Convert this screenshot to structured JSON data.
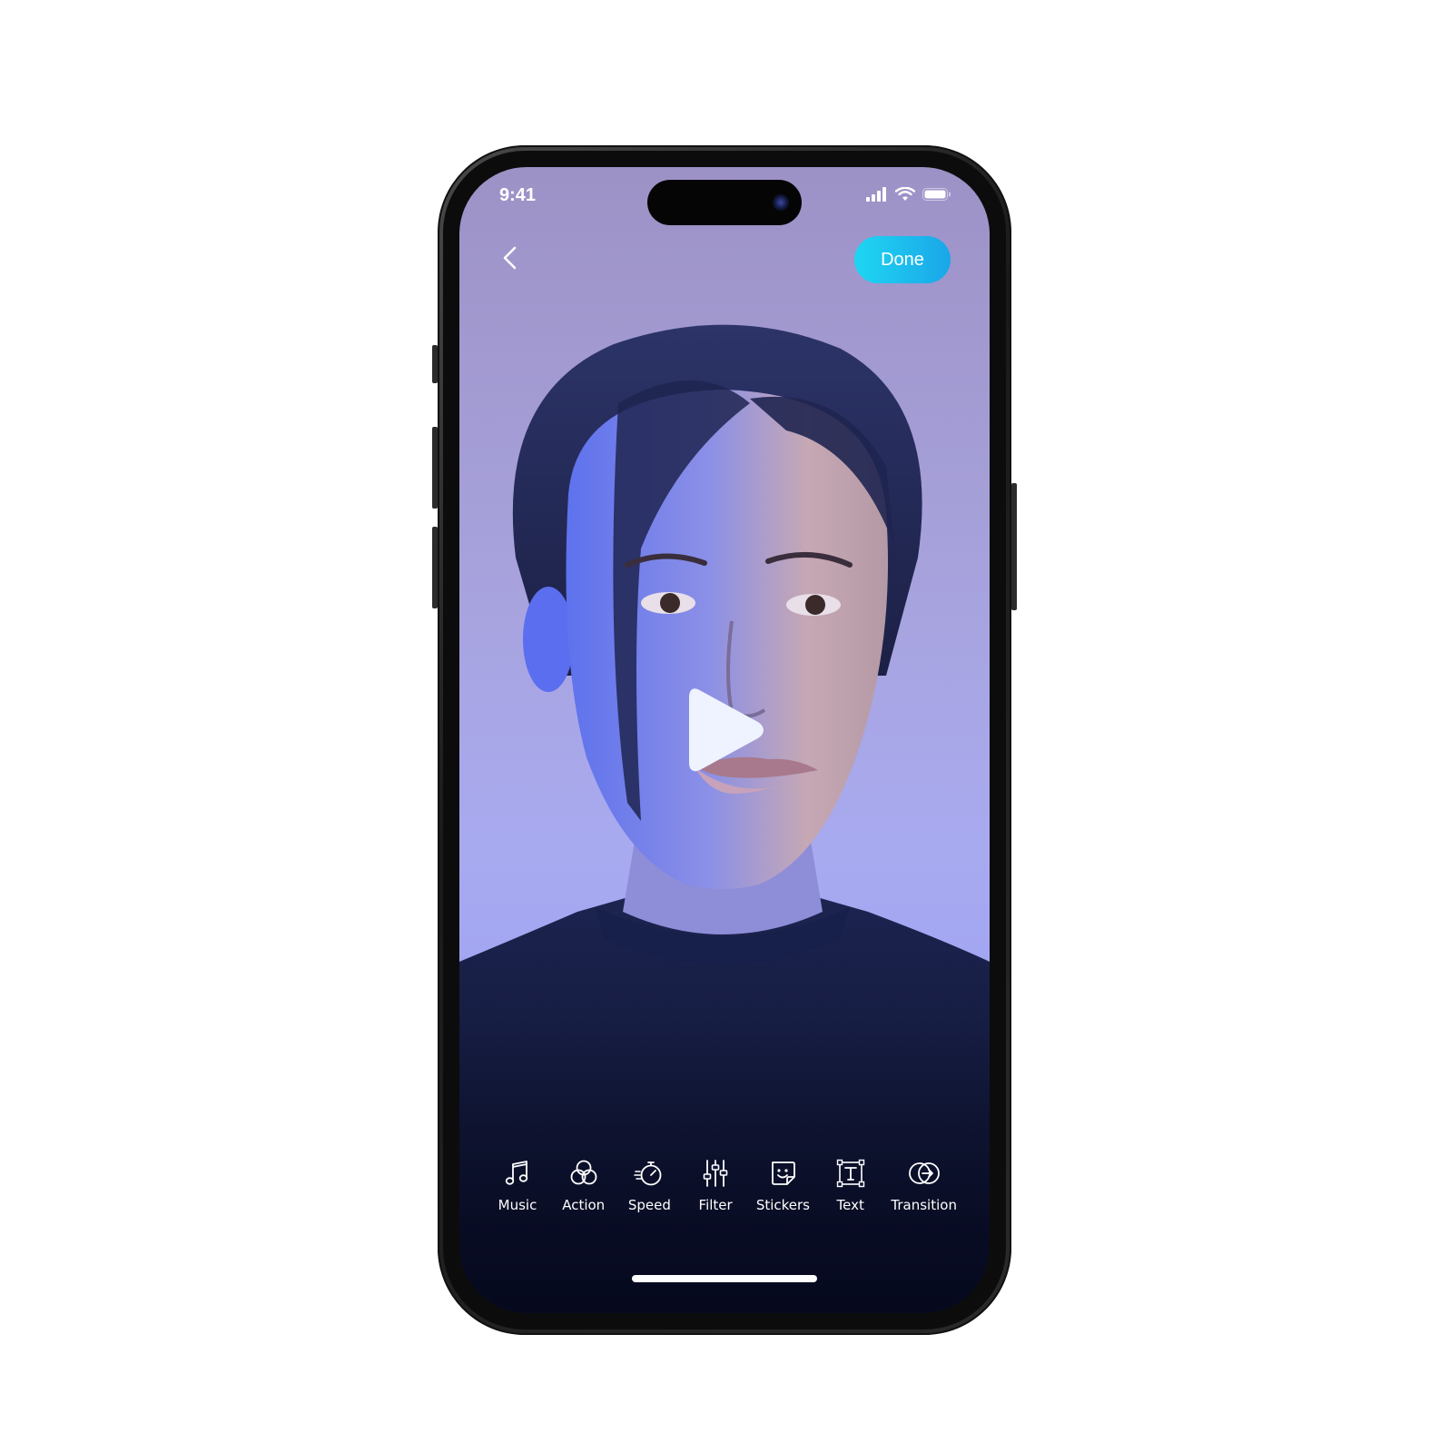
{
  "status_bar": {
    "time": "9:41"
  },
  "nav": {
    "done_label": "Done",
    "back_icon": "chevron-left-icon"
  },
  "player": {
    "play_icon": "play-icon"
  },
  "toolbar": {
    "items": [
      {
        "label": "Music",
        "icon": "music-note-icon"
      },
      {
        "label": "Action",
        "icon": "overlapping-circles-icon"
      },
      {
        "label": "Speed",
        "icon": "stopwatch-icon"
      },
      {
        "label": "Filter",
        "icon": "sliders-icon"
      },
      {
        "label": "Stickers",
        "icon": "sticker-icon"
      },
      {
        "label": "Text",
        "icon": "text-box-icon"
      },
      {
        "label": "Transition",
        "icon": "transition-icon"
      }
    ]
  },
  "colors": {
    "done_gradient_start": "#1fd6f3",
    "done_gradient_end": "#1aa6e8",
    "background_top": "#9d92c6",
    "background_bottom": "#0d1230"
  }
}
